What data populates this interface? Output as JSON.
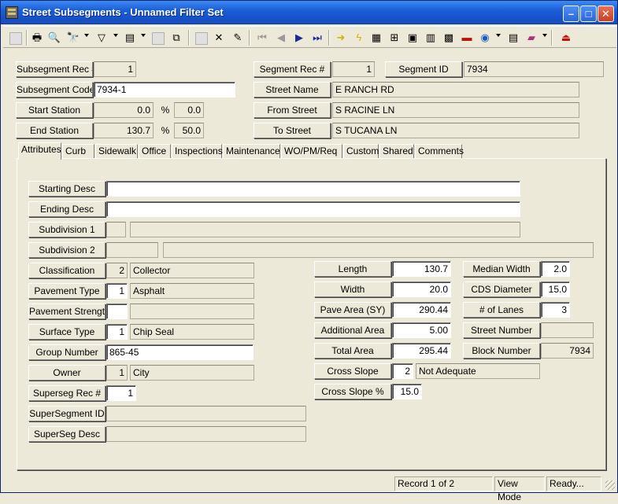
{
  "window": {
    "title": "Street Subsegments - Unnamed Filter Set"
  },
  "header": {
    "subsegment_rec_label": "Subsegment Rec #",
    "subsegment_rec_value": "1",
    "subsegment_code_label": "Subsegment Code",
    "subsegment_code_value": "7934-1",
    "start_station_label": "Start Station",
    "start_station_value": "0.0",
    "start_station_pct": "0.0",
    "end_station_label": "End Station",
    "end_station_value": "130.7",
    "end_station_pct": "50.0",
    "percent_symbol": "%",
    "segment_rec_label": "Segment Rec #",
    "segment_rec_value": "1",
    "segment_id_label": "Segment ID",
    "segment_id_value": "7934",
    "street_name_label": "Street Name",
    "street_name_value": "E RANCH RD",
    "from_street_label": "From Street",
    "from_street_value": "S RACINE LN",
    "to_street_label": "To Street",
    "to_street_value": "S TUCANA LN"
  },
  "tabs": [
    "Attributes",
    "Curb",
    "Sidewalk",
    "Office",
    "Inspections",
    "Maintenance",
    "WO/PM/Req",
    "Custom",
    "Shared",
    "Comments"
  ],
  "attributes": {
    "starting_desc_label": "Starting Desc",
    "starting_desc_value": "",
    "ending_desc_label": "Ending Desc",
    "ending_desc_value": "",
    "subdivision1_label": "Subdivision 1",
    "subdivision2_label": "Subdivision 2",
    "classification_label": "Classification",
    "classification_code": "2",
    "classification_text": "Collector",
    "pavement_type_label": "Pavement Type",
    "pavement_type_code": "1",
    "pavement_type_text": "Asphalt",
    "pavement_strength_label": "Pavement Strength",
    "surface_type_label": "Surface Type",
    "surface_type_code": "1",
    "surface_type_text": "Chip Seal",
    "group_number_label": "Group Number",
    "group_number_value": "865-45",
    "owner_label": "Owner",
    "owner_code": "1",
    "owner_text": "City",
    "superseg_rec_label": "Superseg Rec #",
    "superseg_rec_value": "1",
    "supersegment_id_label": "SuperSegment ID",
    "superseg_desc_label": "SuperSeg Desc",
    "length_label": "Length",
    "length_value": "130.7",
    "width_label": "Width",
    "width_value": "20.0",
    "pave_area_label": "Pave Area (SY)",
    "pave_area_value": "290.44",
    "additional_area_label": "Additional Area",
    "additional_area_value": "5.00",
    "total_area_label": "Total Area",
    "total_area_value": "295.44",
    "cross_slope_label": "Cross Slope",
    "cross_slope_code": "2",
    "cross_slope_text": "Not Adequate",
    "cross_slope_pct_label": "Cross Slope %",
    "cross_slope_pct_value": "15.0",
    "median_width_label": "Median Width",
    "median_width_value": "2.0",
    "cds_diameter_label": "CDS Diameter",
    "cds_diameter_value": "15.0",
    "lanes_label": "# of Lanes",
    "lanes_value": "3",
    "street_number_label": "Street Number",
    "street_number_value": "",
    "block_number_label": "Block Number",
    "block_number_value": "7934"
  },
  "status": {
    "record": "Record 1 of 2",
    "mode": "View Mode",
    "state": "Ready..."
  }
}
